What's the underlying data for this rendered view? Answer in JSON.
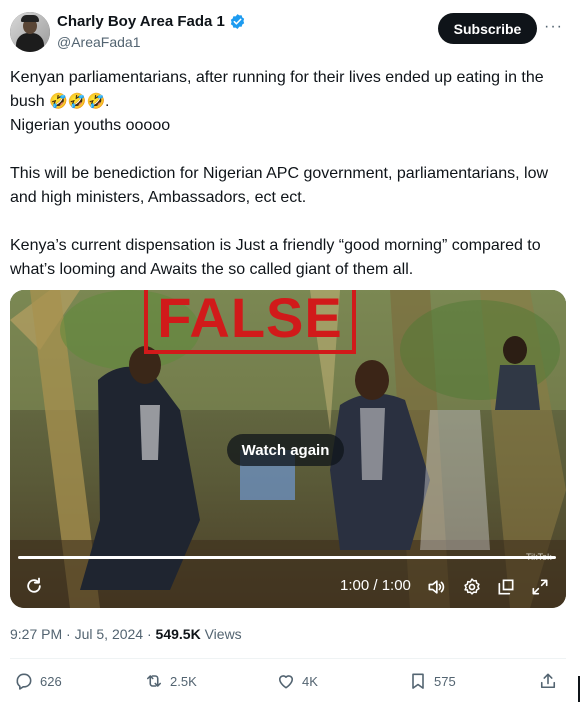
{
  "author": {
    "display_name": "Charly Boy Area Fada 1",
    "handle": "@AreaFada1",
    "verified_icon": "verified-badge-icon",
    "subscribe_label": "Subscribe",
    "more_label": "···"
  },
  "tweet": {
    "line1": "Kenyan parliamentarians, after running for their lives ended up eating in the bush ",
    "emojis": "🤣🤣🤣.",
    "line2": "Nigerian youths ooooo",
    "line3": "This will be benediction for Nigerian APC government, parliamentarians, low and high ministers, Ambassadors, ect ect.",
    "line4": "Kenya’s current dispensation is Just a friendly “good morning” compared to what’s looming and Awaits the so called giant of them all."
  },
  "video": {
    "stamp": "FALSE",
    "watch_again_label": "Watch again",
    "time_label": "1:00 / 1:00",
    "watermark": "TikTok",
    "progress": 1.0,
    "icons": [
      "replay-icon",
      "volume-icon",
      "settings-icon",
      "popout-icon",
      "fullscreen-icon"
    ]
  },
  "meta": {
    "time": "9:27 PM",
    "separator": " · ",
    "date": "Jul 5, 2024",
    "views_count": "549.5K",
    "views_label": " Views"
  },
  "actions": {
    "replies": "626",
    "reposts": "2.5K",
    "likes": "4K",
    "bookmarks": "575"
  },
  "colors": {
    "accent": "#1d9bf0",
    "text": "#0f1419",
    "muted": "#536471",
    "stamp_red": "#d11a1a"
  }
}
